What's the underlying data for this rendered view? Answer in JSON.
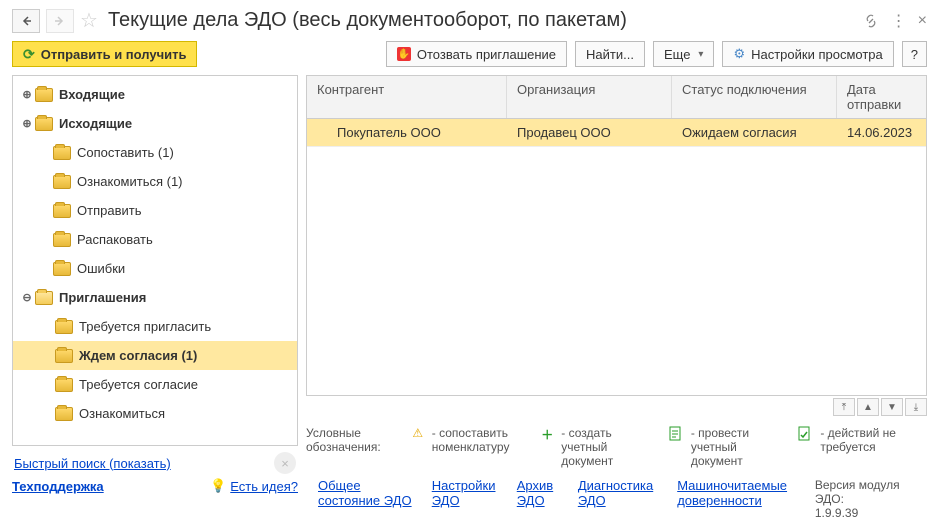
{
  "title": "Текущие дела ЭДО (весь документооборот, по пакетам)",
  "toolbar": {
    "send_receive": "Отправить и получить",
    "revoke_invite": "Отозвать приглашение",
    "find": "Найти...",
    "more": "Еще",
    "view_settings": "Настройки просмотра",
    "help": "?"
  },
  "tree": {
    "inbox": "Входящие",
    "outbox": "Исходящие",
    "match": "Сопоставить (1)",
    "review": "Ознакомиться (1)",
    "send": "Отправить",
    "unpack": "Распаковать",
    "errors": "Ошибки",
    "invites": "Приглашения",
    "need_invite": "Требуется пригласить",
    "wait_agree": "Ждем согласия (1)",
    "need_agree": "Требуется согласие",
    "review2": "Ознакомиться"
  },
  "sidebar_links": {
    "quick_search": "Быстрый поиск (показать)"
  },
  "table": {
    "headers": {
      "counterparty": "Контрагент",
      "organization": "Организация",
      "conn_status": "Статус подключения",
      "send_date": "Дата отправки"
    },
    "rows": [
      {
        "counterparty": "Покупатель ООО",
        "organization": "Продавец ООО",
        "conn_status": "Ожидаем согласия",
        "send_date": "14.06.2023"
      }
    ]
  },
  "legend": {
    "label": "Условные обозначения:",
    "match": "- сопоставить номенклатуру",
    "create": "- создать учетный документ",
    "post": "- провести учетный документ",
    "none": "- действий не требуется"
  },
  "footer": {
    "support": "Техподдержка",
    "idea": "Есть идея?",
    "overall": "Общее состояние ЭДО",
    "settings": "Настройки ЭДО",
    "archive": "Архив ЭДО",
    "diag": "Диагностика ЭДО",
    "mcd": "Машиночитаемые доверенности",
    "version_label": "Версия модуля ЭДО:",
    "version": "1.9.9.39"
  }
}
